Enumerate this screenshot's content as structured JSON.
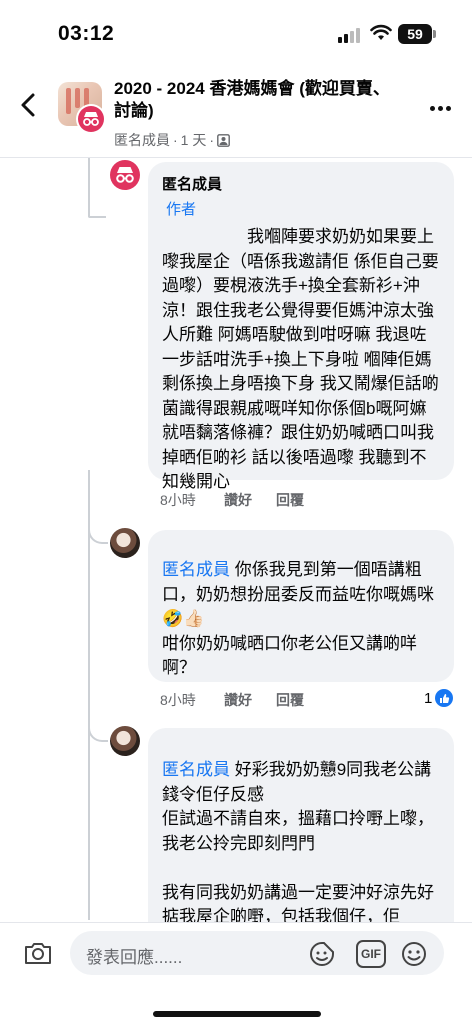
{
  "status_bar": {
    "time": "03:12",
    "battery": "59"
  },
  "header": {
    "title": "2020 - 2024 香港媽媽會 (歡迎買賣、討論)",
    "author": "匿名成員",
    "age": "1 天",
    "separator": "·",
    "icons": [
      "back-icon",
      "more-icon",
      "members-icon"
    ]
  },
  "comments": [
    {
      "author": "匿名成員",
      "badge": "作者",
      "text": "　　　　　我嗰陣要求奶奶如果要上嚟我屋企（唔係我邀請佢 係佢自己要過嚟）要梘液洗手+換全套新衫+沖涼！跟住我老公覺得要佢媽沖涼太強人所難 阿媽唔駛做到咁呀嘛 我退咗一步話咁洗手+換上下身啦 嗰陣佢媽剩係換上身唔換下身 我又鬧爆佢話啲菌識得跟親戚嘅咩知你係個b嘅阿嫲就唔黐落條褲？跟住奶奶喊晒口叫我掉晒佢啲衫 話以後唔過嚟 我聽到不知幾開心",
      "time": "8小時",
      "like": "讚好",
      "reply": "回覆"
    },
    {
      "mention": "匿名成員",
      "text": " 你係我見到第一個唔講粗口，奶奶想扮屈委反而益咗你嘅媽咪🤣👍🏻\n咁你奶奶喊晒口你老公佢又講啲咩啊？",
      "time": "8小時",
      "like": "讚好",
      "reply": "回覆",
      "reaction_count": "1"
    },
    {
      "mention": "匿名成員",
      "text": " 好彩我奶奶戇9同我老公講錢令佢仔反感\n佢試過不請自來，搵藉口拎嘢上嚟，我老公拎完即刻閂門\n\n我有同我奶奶講過一定要沖好涼先好掂我屋企啲嘢，包括我個仔，佢"
    }
  ],
  "composer": {
    "placeholder": "發表回應......",
    "gif_label": "GIF",
    "icons": [
      "camera-icon",
      "sticker-icon",
      "gif-icon",
      "emoji-icon"
    ]
  },
  "colors": {
    "accent": "#1877f2",
    "bubble": "#f0f2f5",
    "anon_avatar": "#e0345f"
  }
}
